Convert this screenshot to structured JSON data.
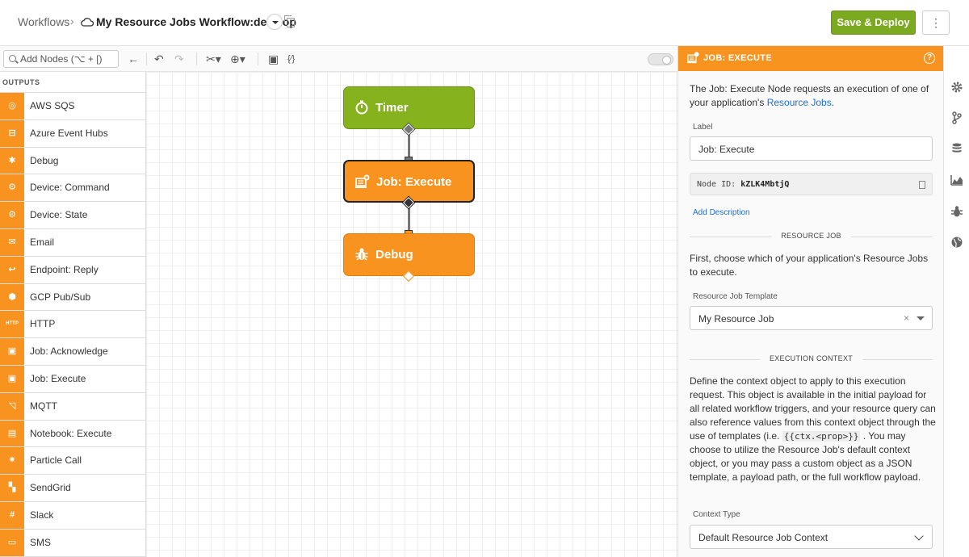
{
  "header": {
    "breadcrumb_root": "Workflows",
    "separator": "›",
    "workflow_title": "My Resource Jobs Workflow:develop",
    "save_label": "Save & Deploy",
    "more_label": "⋮"
  },
  "toolbar": {
    "search_placeholder": "Add Nodes (⌥ + [)",
    "icons": [
      "back-arrow-icon",
      "undo-icon",
      "redo-icon",
      "scissors-icon",
      "zoom-icon",
      "add-comment-icon",
      "variables-icon"
    ]
  },
  "sidebar": {
    "header": "OUTPUTS",
    "items": [
      {
        "label": "AWS SQS",
        "icon": "aws-sqs-icon",
        "glyph": "◎"
      },
      {
        "label": "Azure Event Hubs",
        "icon": "azure-event-hubs-icon",
        "glyph": "⊟"
      },
      {
        "label": "Debug",
        "icon": "bug-icon",
        "glyph": "✱"
      },
      {
        "label": "Device: Command",
        "icon": "device-command-icon",
        "glyph": "⚙"
      },
      {
        "label": "Device: State",
        "icon": "device-state-icon",
        "glyph": "⚙"
      },
      {
        "label": "Email",
        "icon": "email-icon",
        "glyph": "✉"
      },
      {
        "label": "Endpoint: Reply",
        "icon": "endpoint-reply-icon",
        "glyph": "↩"
      },
      {
        "label": "GCP Pub/Sub",
        "icon": "gcp-pubsub-icon",
        "glyph": "⬢"
      },
      {
        "label": "HTTP",
        "icon": "http-icon",
        "glyph": "HTTP"
      },
      {
        "label": "Job: Acknowledge",
        "icon": "job-acknowledge-icon",
        "glyph": "▣"
      },
      {
        "label": "Job: Execute",
        "icon": "job-execute-icon",
        "glyph": "▣"
      },
      {
        "label": "MQTT",
        "icon": "mqtt-icon",
        "glyph": "◹"
      },
      {
        "label": "Notebook: Execute",
        "icon": "notebook-icon",
        "glyph": "▤"
      },
      {
        "label": "Particle Call",
        "icon": "particle-icon",
        "glyph": "✷"
      },
      {
        "label": "SendGrid",
        "icon": "sendgrid-icon",
        "glyph": "▚"
      },
      {
        "label": "Slack",
        "icon": "slack-icon",
        "glyph": "#"
      },
      {
        "label": "SMS",
        "icon": "sms-icon",
        "glyph": "▭"
      }
    ]
  },
  "canvas": {
    "nodes": [
      {
        "label": "Timer",
        "icon": "timer-icon",
        "color": "#86b21e"
      },
      {
        "label": "Job: Execute",
        "icon": "job-execute-icon",
        "color": "#f7931e"
      },
      {
        "label": "Debug",
        "icon": "bug-icon",
        "color": "#f7931e"
      }
    ]
  },
  "panel": {
    "title": "JOB: EXECUTE",
    "intro_prefix": "The Job: Execute Node requests an execution of one of your application's ",
    "intro_link": "Resource Jobs",
    "intro_suffix": ".",
    "label_label": "Label",
    "label_value": "Job: Execute",
    "node_id_label": "Node ID:",
    "node_id_value": "kZLK4MbtjQ",
    "add_description": "Add Description",
    "section_resource_job": "RESOURCE JOB",
    "resource_job_text": "First, choose which of your application's Resource Jobs to execute.",
    "template_label": "Resource Job Template",
    "template_value": "My Resource Job",
    "template_clear": "×",
    "section_execution_context": "EXECUTION CONTEXT",
    "context_text_1": "Define the context object to apply to this execution request. This object is available in the initial payload for all related workflow triggers, and your resource query can also reference values from this context object through the use of templates (i.e. ",
    "context_code": "{{ctx.<prop>}}",
    "context_text_2": " . You may choose to utilize the Resource Job's default context object, or you may pass a custom object as a JSON template, a payload path, or the full workflow payload.",
    "context_type_label": "Context Type",
    "context_type_value": "Default Resource Job Context"
  },
  "rail": {
    "icons": [
      "gear-icon",
      "branch-icon",
      "database-icon",
      "chart-icon",
      "bug-icon",
      "globe-icon"
    ]
  },
  "colors": {
    "accent_orange": "#f7931e",
    "accent_green": "#86b21e",
    "save_green": "#7ba920",
    "link_blue": "#1c6ed5"
  }
}
